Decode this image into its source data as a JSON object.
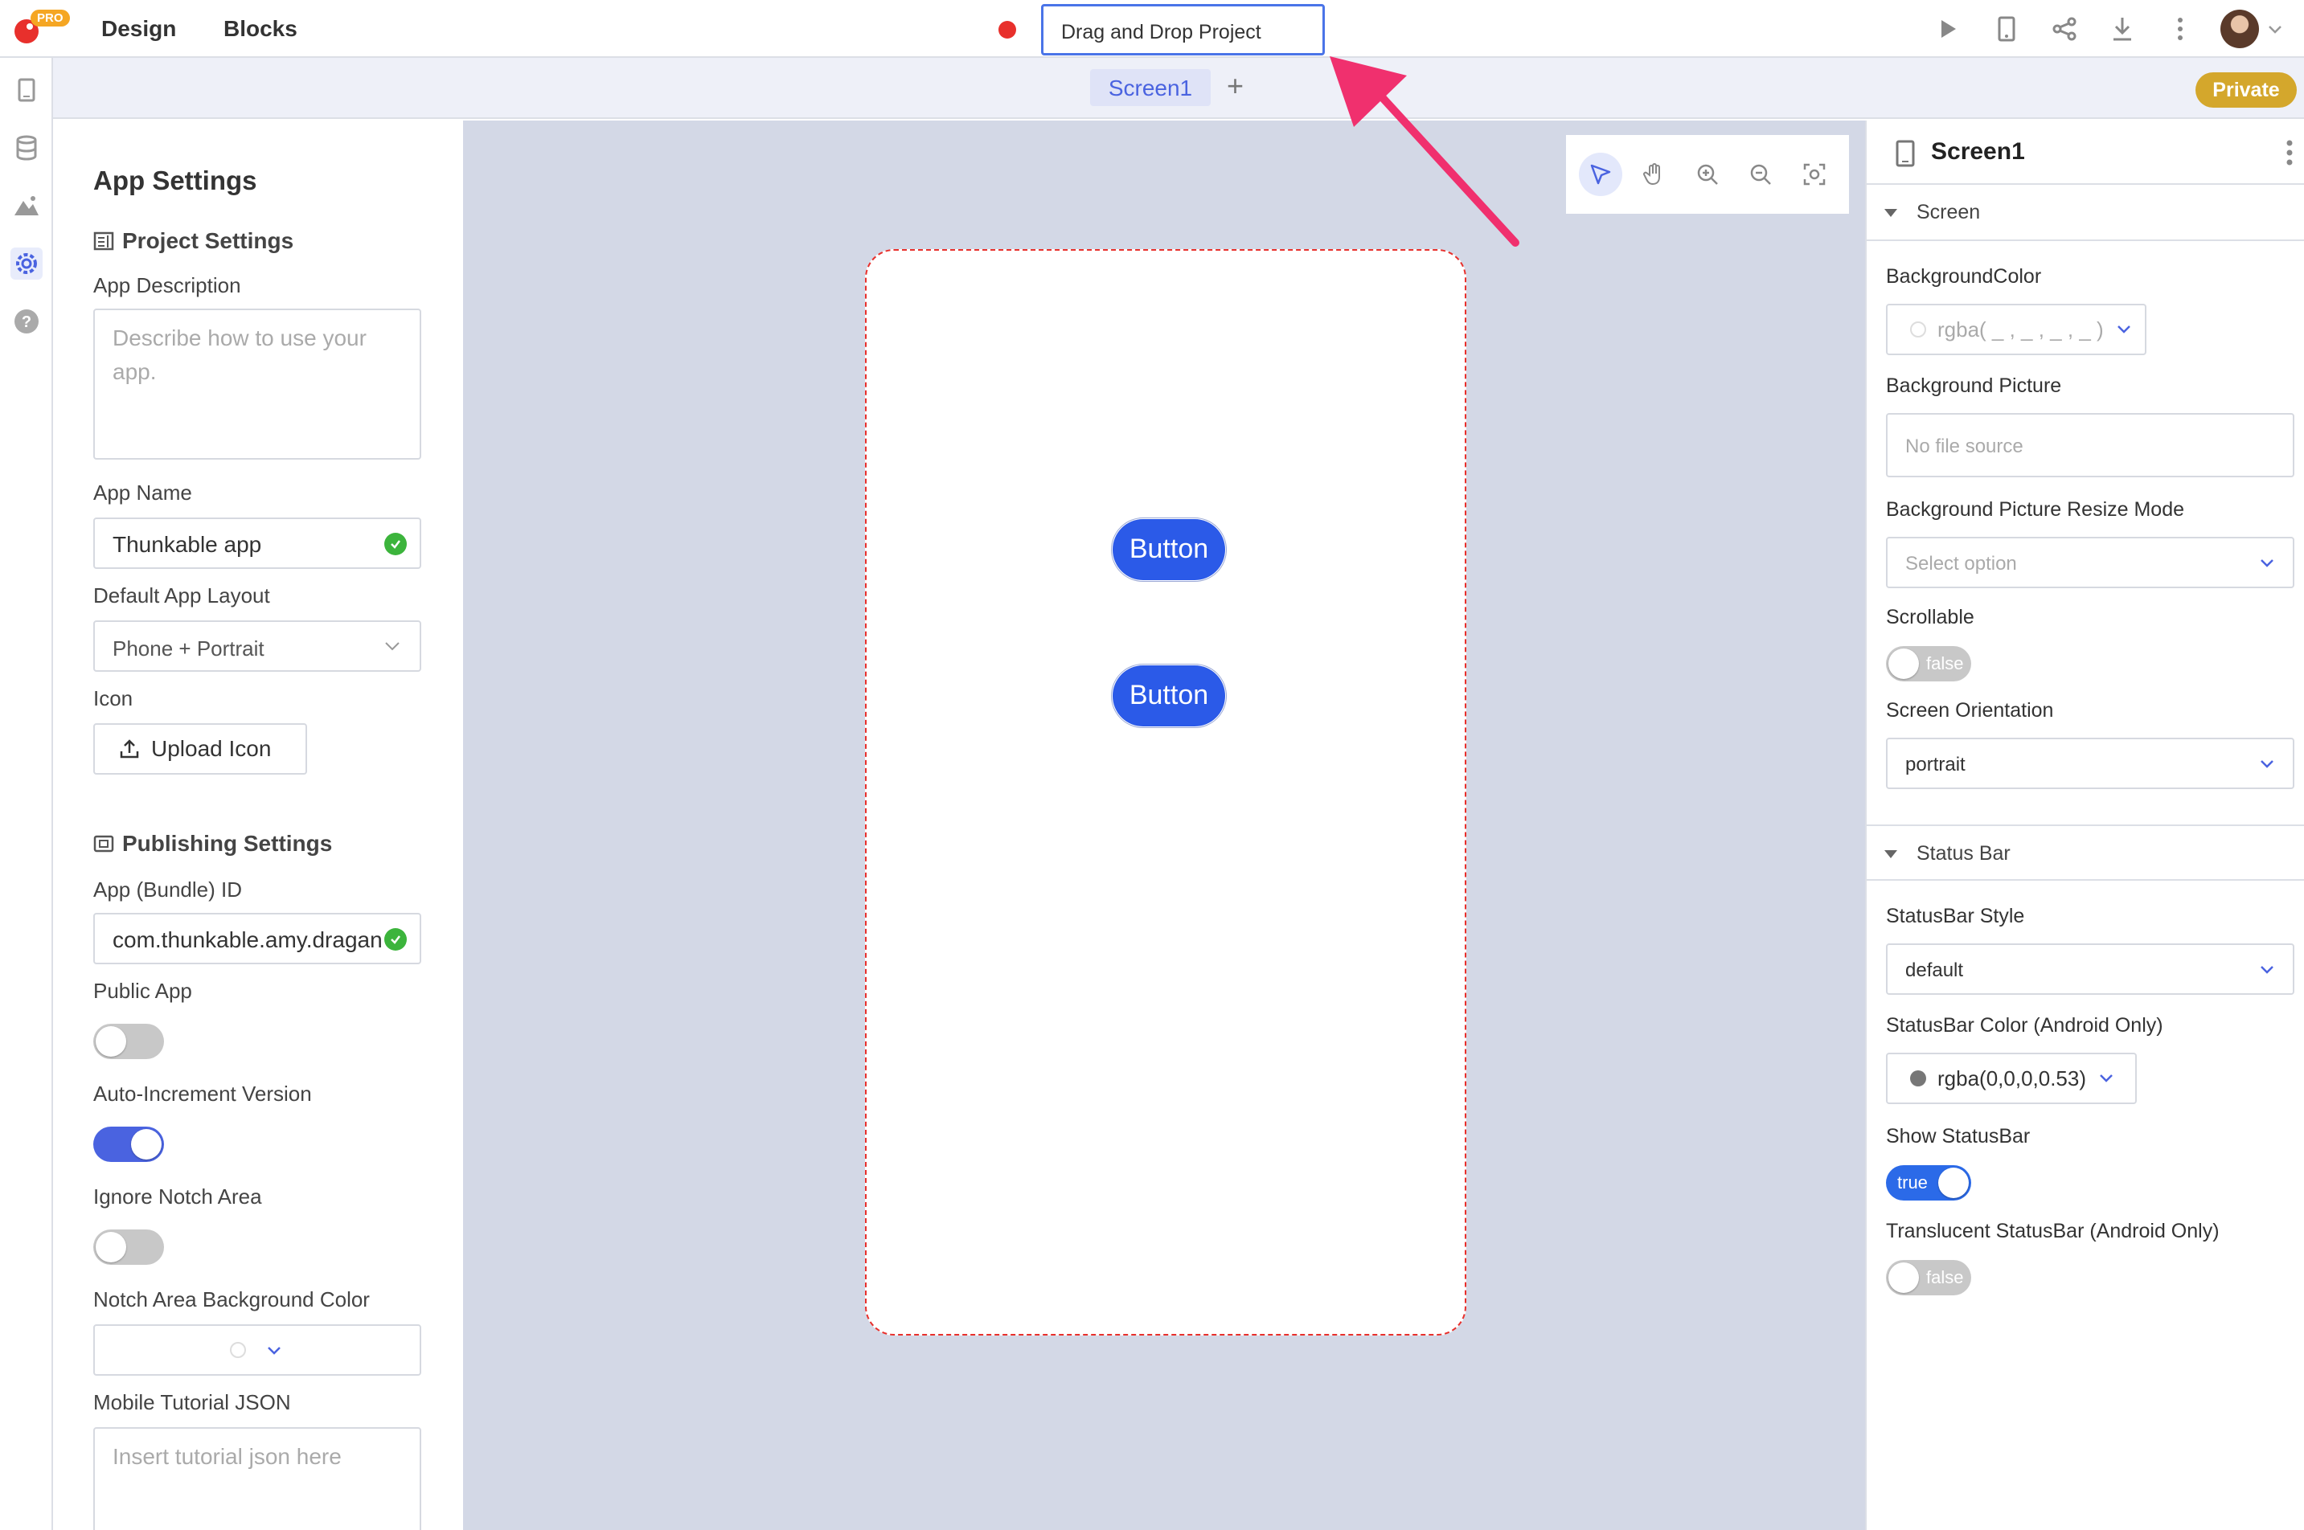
{
  "topbar": {
    "logo_badge": "PRO",
    "menu": [
      "Design",
      "Blocks"
    ],
    "project_title": "Drag and Drop Project",
    "icons": [
      "play-icon",
      "phone-preview-icon",
      "share-icon",
      "download-icon",
      "more-vertical-icon",
      "avatar",
      "chevron-down-icon"
    ]
  },
  "rail": {
    "icons": [
      "phone-icon",
      "database-icon",
      "image-icon",
      "settings-gear-icon",
      "help-icon"
    ],
    "active": "settings-gear-icon"
  },
  "tabs": {
    "screen_tab": "Screen1",
    "add_label": "+",
    "private_label": "Private"
  },
  "app_settings": {
    "title": "App Settings",
    "project_settings_heading": "Project Settings",
    "app_description_label": "App Description",
    "app_description_placeholder": "Describe how to use your app.",
    "app_name_label": "App Name",
    "app_name_value": "Thunkable app",
    "default_layout_label": "Default App Layout",
    "default_layout_value": "Phone + Portrait",
    "icon_label": "Icon",
    "upload_icon_label": "Upload Icon",
    "publishing_settings_heading": "Publishing Settings",
    "bundle_id_label": "App (Bundle) ID",
    "bundle_id_value": "com.thunkable.amy.dragan",
    "public_app_label": "Public App",
    "public_app_on": false,
    "auto_increment_label": "Auto-Increment Version",
    "auto_increment_on": true,
    "ignore_notch_label": "Ignore Notch Area",
    "ignore_notch_on": false,
    "notch_bg_label": "Notch Area Background Color",
    "tutorial_json_label": "Mobile Tutorial JSON",
    "tutorial_json_placeholder": "Insert tutorial json here"
  },
  "canvas": {
    "buttons": [
      "Button",
      "Button"
    ],
    "tools": [
      "select-pointer-icon",
      "hand-pan-icon",
      "zoom-in-icon",
      "zoom-out-icon",
      "fit-screen-icon"
    ],
    "active_tool": "select-pointer-icon"
  },
  "properties": {
    "title": "Screen1",
    "screen_section": "Screen",
    "background_color_label": "BackgroundColor",
    "background_color_value": "rgba( _ , _ , _ , _ )",
    "background_picture_label": "Background Picture",
    "background_picture_placeholder": "No file source",
    "resize_mode_label": "Background Picture Resize Mode",
    "resize_mode_placeholder": "Select option",
    "scrollable_label": "Scrollable",
    "scrollable_value": "false",
    "orientation_label": "Screen Orientation",
    "orientation_value": "portrait",
    "status_bar_section": "Status Bar",
    "statusbar_style_label": "StatusBar Style",
    "statusbar_style_value": "default",
    "statusbar_color_label": "StatusBar Color (Android Only)",
    "statusbar_color_value": "rgba(0,0,0,0.53)",
    "show_statusbar_label": "Show StatusBar",
    "show_statusbar_value": "true",
    "translucent_label": "Translucent StatusBar (Android Only)",
    "translucent_value": "false"
  },
  "colors": {
    "accent": "#4a63e0",
    "button_blue": "#2b5ae8",
    "canvas_bg": "#d3d8e6",
    "private_badge": "#d4a72c",
    "annotation_arrow": "#f0306e",
    "success_green": "#3cb43c"
  }
}
